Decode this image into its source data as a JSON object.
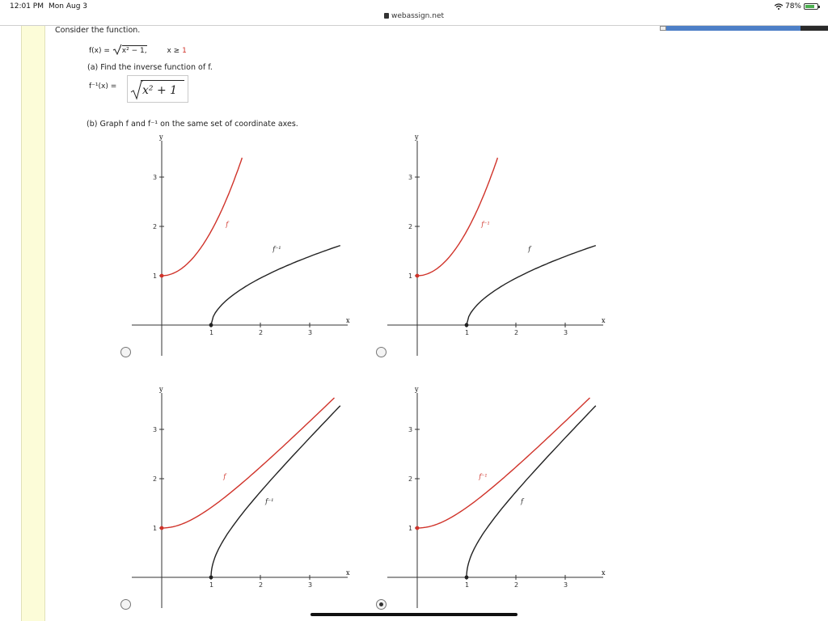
{
  "status_bar": {
    "time": "12:01 PM",
    "date": "Mon Aug 3",
    "url": "webassign.net",
    "battery": "78%"
  },
  "question": {
    "intro": "Consider the function.",
    "function_lhs": "f(x) =",
    "function_radicand": "x² − 1,",
    "condition": "x ≥ ",
    "condition_value": "1",
    "part_a": "(a) Find the inverse function of f.",
    "inverse_label": "f⁻¹(x) =",
    "inverse_answer": "x² + 1",
    "part_b": "(b) Graph f and f⁻¹ on the same set of coordinate axes."
  },
  "axis_labels": {
    "x": "x",
    "y": "y"
  },
  "tick_labels": {
    "x": [
      "1",
      "2",
      "3"
    ],
    "y": [
      "1",
      "2",
      "3"
    ]
  },
  "curve_labels": {
    "f": "f",
    "finv": "f⁻¹"
  },
  "colors": {
    "red": "#d0332a",
    "black": "#222222",
    "accent_bar": "#4d7fc7"
  },
  "options": [
    {
      "selected": false,
      "red_label": "f",
      "black_label": "f⁻¹",
      "red_curve": "sqrt(x^2+1)",
      "black_curve": "sqrt(x-1)+1 (steep)"
    },
    {
      "selected": false,
      "red_label": "f⁻¹",
      "black_label": "f",
      "red_curve": "sqrt(x^2+1)",
      "black_curve": "sqrt(x-1)+1 (steep)"
    },
    {
      "selected": false,
      "red_label": "f",
      "black_label": "f⁻¹",
      "red_curve": "sqrt(x^2+1)",
      "black_curve": "sqrt(x^2-1)"
    },
    {
      "selected": true,
      "red_label": "f⁻¹",
      "black_label": "f",
      "red_curve": "sqrt(x^2+1)",
      "black_curve": "sqrt(x^2-1)"
    }
  ]
}
